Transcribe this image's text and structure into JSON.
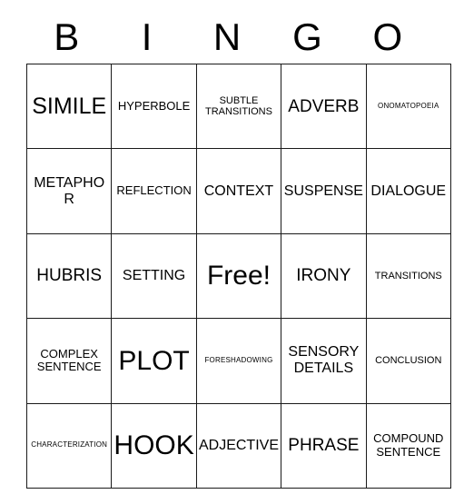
{
  "card": {
    "title": "BINGO",
    "header_letters": [
      "B",
      "I",
      "N",
      "G",
      "O"
    ],
    "free_space_label": "Free!",
    "free_space_position": {
      "row": 3,
      "column": 3
    },
    "grid_size": "5x5",
    "colors": {
      "text": "#000000",
      "border": "#1a1a1a",
      "background": "#ffffff"
    },
    "rows": [
      [
        {
          "text": "SIMILE",
          "size": "fs-xl"
        },
        {
          "text": "HYPERBOLE",
          "size": "fs-s"
        },
        {
          "text": "SUBTLE TRANSITIONS",
          "size": "fs-xs"
        },
        {
          "text": "ADVERB",
          "size": "fs-l"
        },
        {
          "text": "ONOMATOPOEIA",
          "size": "fs-xxs"
        }
      ],
      [
        {
          "text": "METAPHOR",
          "size": "fs-m"
        },
        {
          "text": "REFLECTION",
          "size": "fs-s"
        },
        {
          "text": "CONTEXT",
          "size": "fs-m"
        },
        {
          "text": "SUSPENSE",
          "size": "fs-m"
        },
        {
          "text": "DIALOGUE",
          "size": "fs-m"
        }
      ],
      [
        {
          "text": "HUBRIS",
          "size": "fs-l"
        },
        {
          "text": "SETTING",
          "size": "fs-m"
        },
        {
          "text": "Free!",
          "size": "fs-xxl"
        },
        {
          "text": "IRONY",
          "size": "fs-l"
        },
        {
          "text": "TRANSITIONS",
          "size": "fs-xs"
        }
      ],
      [
        {
          "text": "COMPLEX SENTENCE",
          "size": "fs-s"
        },
        {
          "text": "PLOT",
          "size": "fs-xxl"
        },
        {
          "text": "FORESHADOWING",
          "size": "fs-xxs"
        },
        {
          "text": "SENSORY DETAILS",
          "size": "fs-m"
        },
        {
          "text": "CONCLUSION",
          "size": "fs-xs"
        }
      ],
      [
        {
          "text": "CHARACTERIZATION",
          "size": "fs-xxs"
        },
        {
          "text": "HOOK",
          "size": "fs-xxl"
        },
        {
          "text": "ADJECTIVE",
          "size": "fs-m"
        },
        {
          "text": "PHRASE",
          "size": "fs-l"
        },
        {
          "text": "COMPOUND SENTENCE",
          "size": "fs-s"
        }
      ]
    ]
  }
}
